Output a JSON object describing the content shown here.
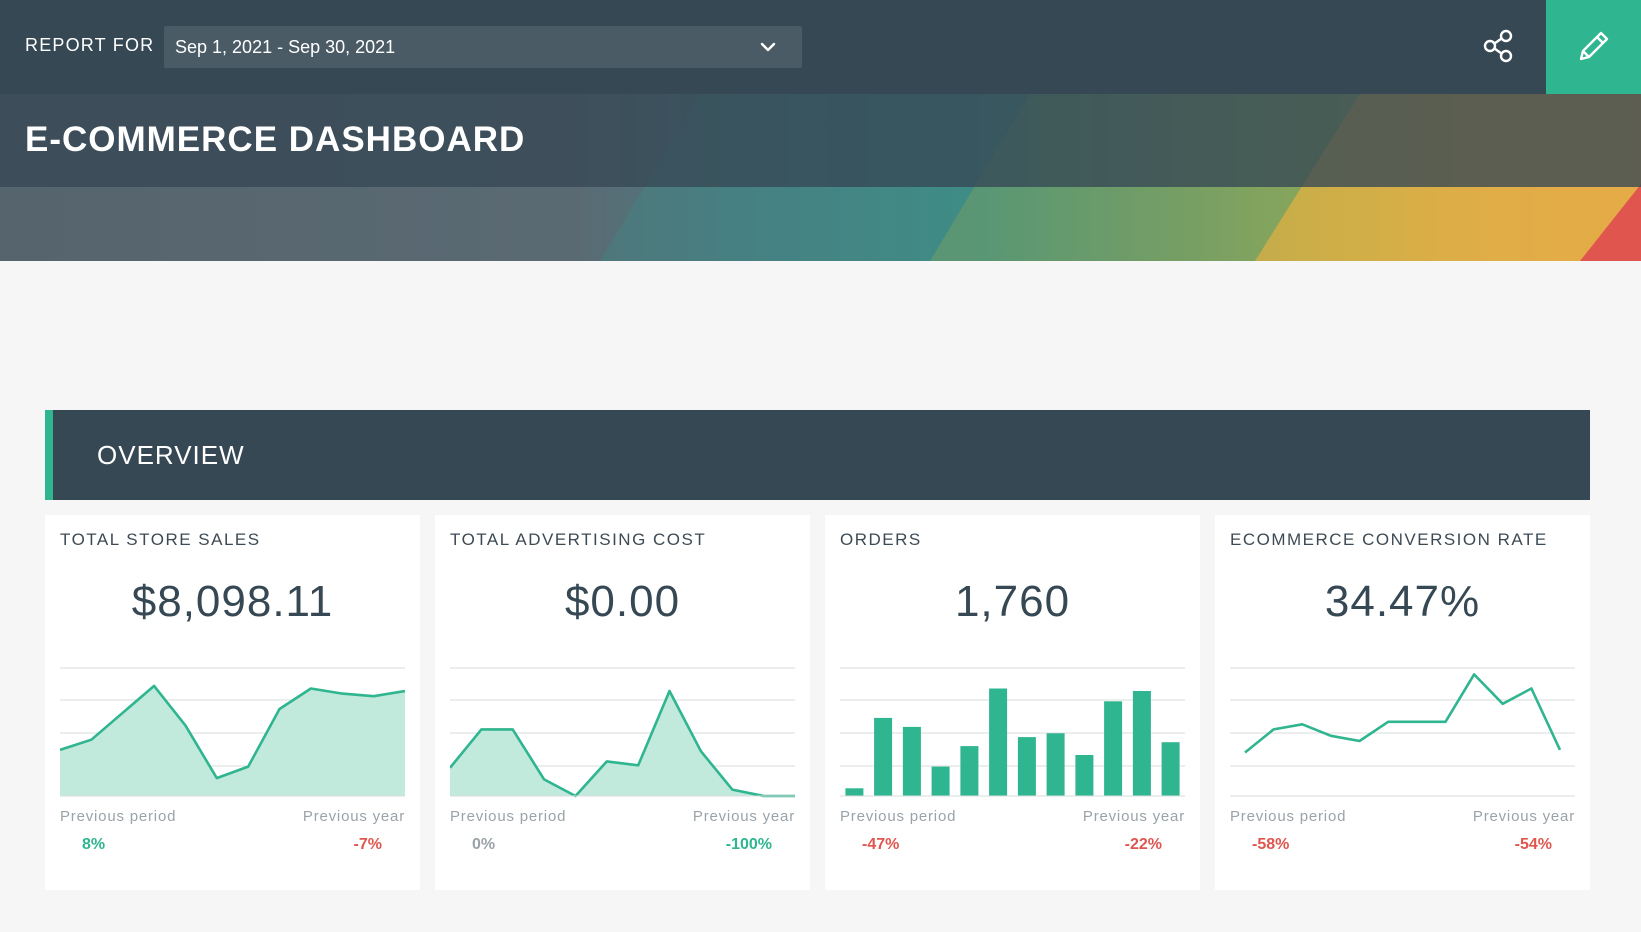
{
  "header": {
    "report_for_label": "REPORT FOR",
    "date_range": "Sep 1, 2021 - Sep 30, 2021",
    "share_icon": "share-icon",
    "edit_icon": "pencil-icon"
  },
  "banner": {
    "title": "E-COMMERCE DASHBOARD"
  },
  "overview": {
    "title": "OVERVIEW"
  },
  "colors": {
    "dark": "#364854",
    "accent": "#2fb58f",
    "negative": "#e0564f",
    "muted": "#9aa3a9"
  },
  "cards": [
    {
      "title": "TOTAL STORE SALES",
      "value": "$8,098.11",
      "prev_period_label": "Previous period",
      "prev_year_label": "Previous year",
      "prev_period_change": "8%",
      "prev_year_change": "-7%",
      "prev_period_trend": "pos",
      "prev_year_trend": "neg"
    },
    {
      "title": "TOTAL ADVERTISING COST",
      "value": "$0.00",
      "prev_period_label": "Previous period",
      "prev_year_label": "Previous year",
      "prev_period_change": "0%",
      "prev_year_change": "-100%",
      "prev_period_trend": "neu",
      "prev_year_trend": "pos"
    },
    {
      "title": "ORDERS",
      "value": "1,760",
      "prev_period_label": "Previous period",
      "prev_year_label": "Previous year",
      "prev_period_change": "-47%",
      "prev_year_change": "-22%",
      "prev_period_trend": "neg",
      "prev_year_trend": "neg"
    },
    {
      "title": "ECOMMERCE CONVERSION RATE",
      "value": "34.47%",
      "prev_period_label": "Previous period",
      "prev_year_label": "Previous year",
      "prev_period_change": "-58%",
      "prev_year_change": "-54%",
      "prev_period_trend": "neg",
      "prev_year_trend": "neg"
    }
  ],
  "chart_data": [
    {
      "type": "area",
      "title": "TOTAL STORE SALES",
      "values": [
        0.36,
        0.44,
        0.65,
        0.86,
        0.55,
        0.14,
        0.23,
        0.68,
        0.84,
        0.8,
        0.78,
        0.82
      ],
      "ylim": [
        0,
        1
      ],
      "grid": true
    },
    {
      "type": "area",
      "title": "TOTAL ADVERTISING COST",
      "values": [
        0.22,
        0.52,
        0.52,
        0.13,
        0.0,
        0.27,
        0.24,
        0.82,
        0.35,
        0.05,
        0.0,
        0.0
      ],
      "ylim": [
        0,
        1
      ],
      "grid": true
    },
    {
      "type": "bar",
      "title": "ORDERS",
      "values": [
        0.06,
        0.61,
        0.54,
        0.23,
        0.39,
        0.84,
        0.46,
        0.49,
        0.32,
        0.74,
        0.82,
        0.42
      ],
      "ylim": [
        0,
        1
      ],
      "grid": true
    },
    {
      "type": "line",
      "title": "ECOMMERCE CONVERSION RATE",
      "values": [
        0.34,
        0.52,
        0.56,
        0.47,
        0.43,
        0.58,
        0.58,
        0.58,
        0.95,
        0.72,
        0.84,
        0.36
      ],
      "ylim": [
        0,
        1
      ],
      "grid": true
    }
  ]
}
